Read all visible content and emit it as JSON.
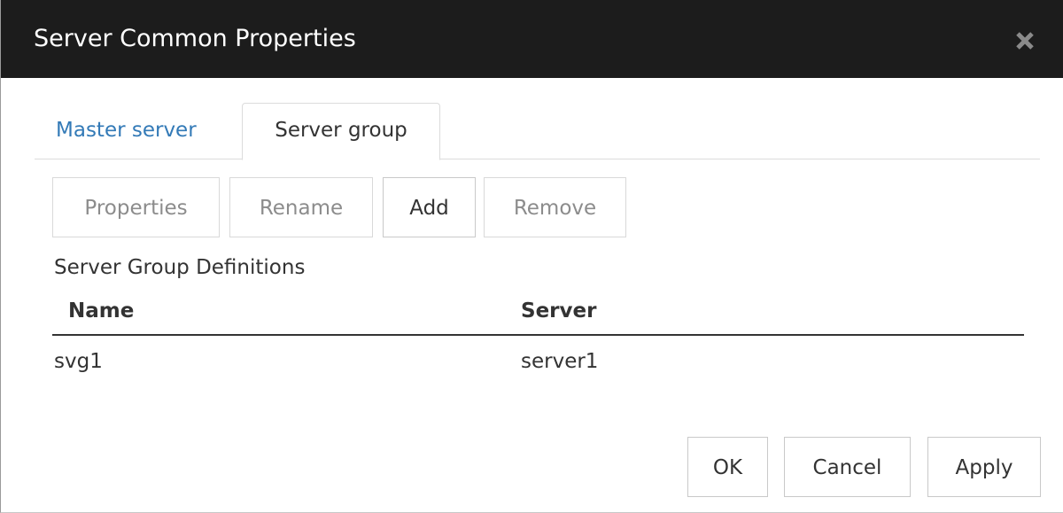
{
  "dialog": {
    "title": "Server Common Properties",
    "close_icon": "close-icon"
  },
  "tabs": [
    {
      "label": "Master server",
      "active": false
    },
    {
      "label": "Server group",
      "active": true
    }
  ],
  "toolbar": {
    "properties_label": "Properties",
    "properties_enabled": false,
    "rename_label": "Rename",
    "rename_enabled": false,
    "add_label": "Add",
    "add_enabled": true,
    "remove_label": "Remove",
    "remove_enabled": false
  },
  "definitions": {
    "section_label": "Server Group Definitions",
    "columns": [
      "Name",
      "Server"
    ],
    "rows": [
      {
        "name": "svg1",
        "server": "server1"
      }
    ]
  },
  "footer": {
    "ok_label": "OK",
    "cancel_label": "Cancel",
    "apply_label": "Apply"
  },
  "colors": {
    "titlebar": "#1c1c1c",
    "link_tab": "#337ab7",
    "disabled_text": "#8c8c8c"
  }
}
